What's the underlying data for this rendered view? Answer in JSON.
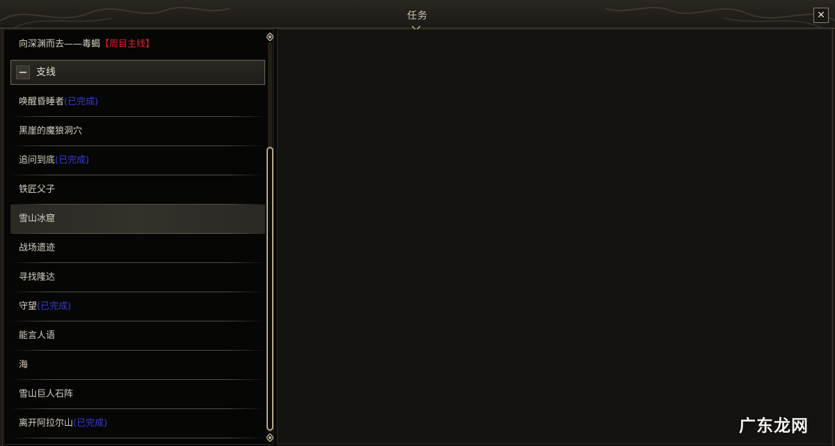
{
  "window": {
    "title": "任务",
    "close_icon": "close-icon"
  },
  "quests": {
    "main_item": {
      "name": "向深渊而去——毒蝎",
      "tag": "【周目主线】"
    },
    "section": {
      "label": "支线",
      "toggle_icon": "collapse-minus-icon"
    },
    "items": [
      {
        "name": "唤醒昏睡者",
        "status": "(已完成)"
      },
      {
        "name": "黑崖的魔狼洞穴",
        "status": ""
      },
      {
        "name": "追问到底",
        "status": "(已完成)"
      },
      {
        "name": "铁匠父子",
        "status": ""
      },
      {
        "name": "雪山冰窟",
        "status": ""
      },
      {
        "name": "战场遗迹",
        "status": ""
      },
      {
        "name": "寻找隆达",
        "status": ""
      },
      {
        "name": "守望",
        "status": "(已完成)"
      },
      {
        "name": "能言人语",
        "status": ""
      },
      {
        "name": "海",
        "status": ""
      },
      {
        "name": "雪山巨人石阵",
        "status": ""
      },
      {
        "name": "离开阿拉尔山",
        "status": "(已完成)"
      }
    ],
    "selected_index": 4
  },
  "watermark": "广东龙网",
  "colors": {
    "main_tag": "#e0222a",
    "completed_tag": "#3a3ad8",
    "accent_gold": "#b8ad8e"
  }
}
